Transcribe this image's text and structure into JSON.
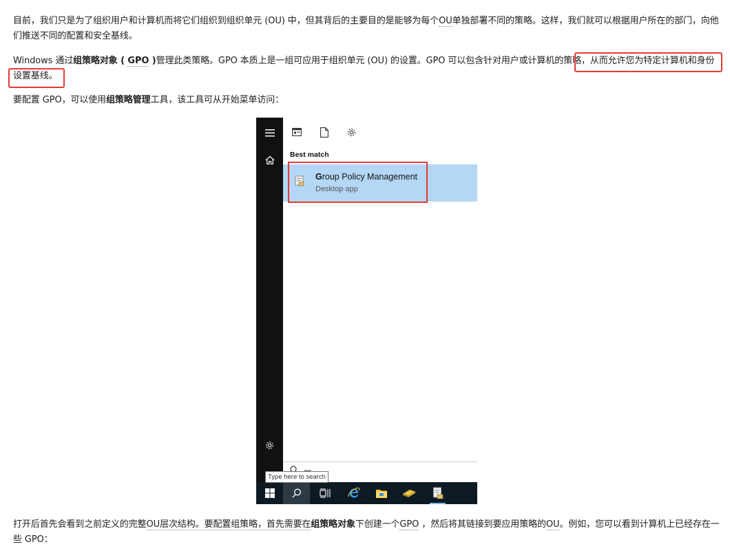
{
  "para1": {
    "s1": "目前，我们只是为了组织用户和计算机而将它们组织到组织单元 (OU) 中，但其背后的主要目的是能够为每个",
    "s2": "OU",
    "s3": "单独部署不同的策略。这样，我们就可以根据用户所在的部门，向他们推送不同的配置和安全基线。"
  },
  "para2": {
    "s1": "Windows 通过",
    "b1": "组策略对象 ( ",
    "b2": "GPO",
    "b3": " )",
    "s2": "管理此类策略。GPO 本质上是一组可应用于组织单元 (OU) 的设置。GPO 可以包含针对用户或计算机的策略，",
    "s3": "从而允许您为特定计算机和身份设置基线。"
  },
  "para3": {
    "s1": "要配置 GPO，可以使用",
    "b1": "组策略管理",
    "s2": "工具，该工具可从开始菜单访问："
  },
  "para4": {
    "s1": "打开后首先会看到之前定义的完整",
    "u1": "OU层次结构。要配置组策略，首先需要在",
    "b1": "组策略对象",
    "s2": "下创建一个",
    "u2": "GPO",
    "s3": " ，然后将其链接到要应用策略的",
    "u3": "OU",
    "s4": "。例如，您可以看到计算机上已经存在一些 GPO："
  },
  "screenshot": {
    "best_match_label": "Best match",
    "result_title_bold": "G",
    "result_title_rest": "roup Policy Management",
    "result_subtitle": "Desktop app",
    "search_value": "gr",
    "tooltip": "Type here to search",
    "icons": [
      "menu-icon",
      "home-icon",
      "settings-icon",
      "app-icon",
      "document-icon",
      "gear-icon",
      "search-icon",
      "windows-start-icon",
      "task-view-icon",
      "internet-explorer-icon",
      "file-explorer-icon",
      "server-tool-icon",
      "group-policy-icon"
    ]
  },
  "colors": {
    "highlight_border": "#e53935",
    "result_bg": "#b4d7f5",
    "sidebar_bg": "#111111",
    "taskbar_bg": "#0d1a24"
  }
}
